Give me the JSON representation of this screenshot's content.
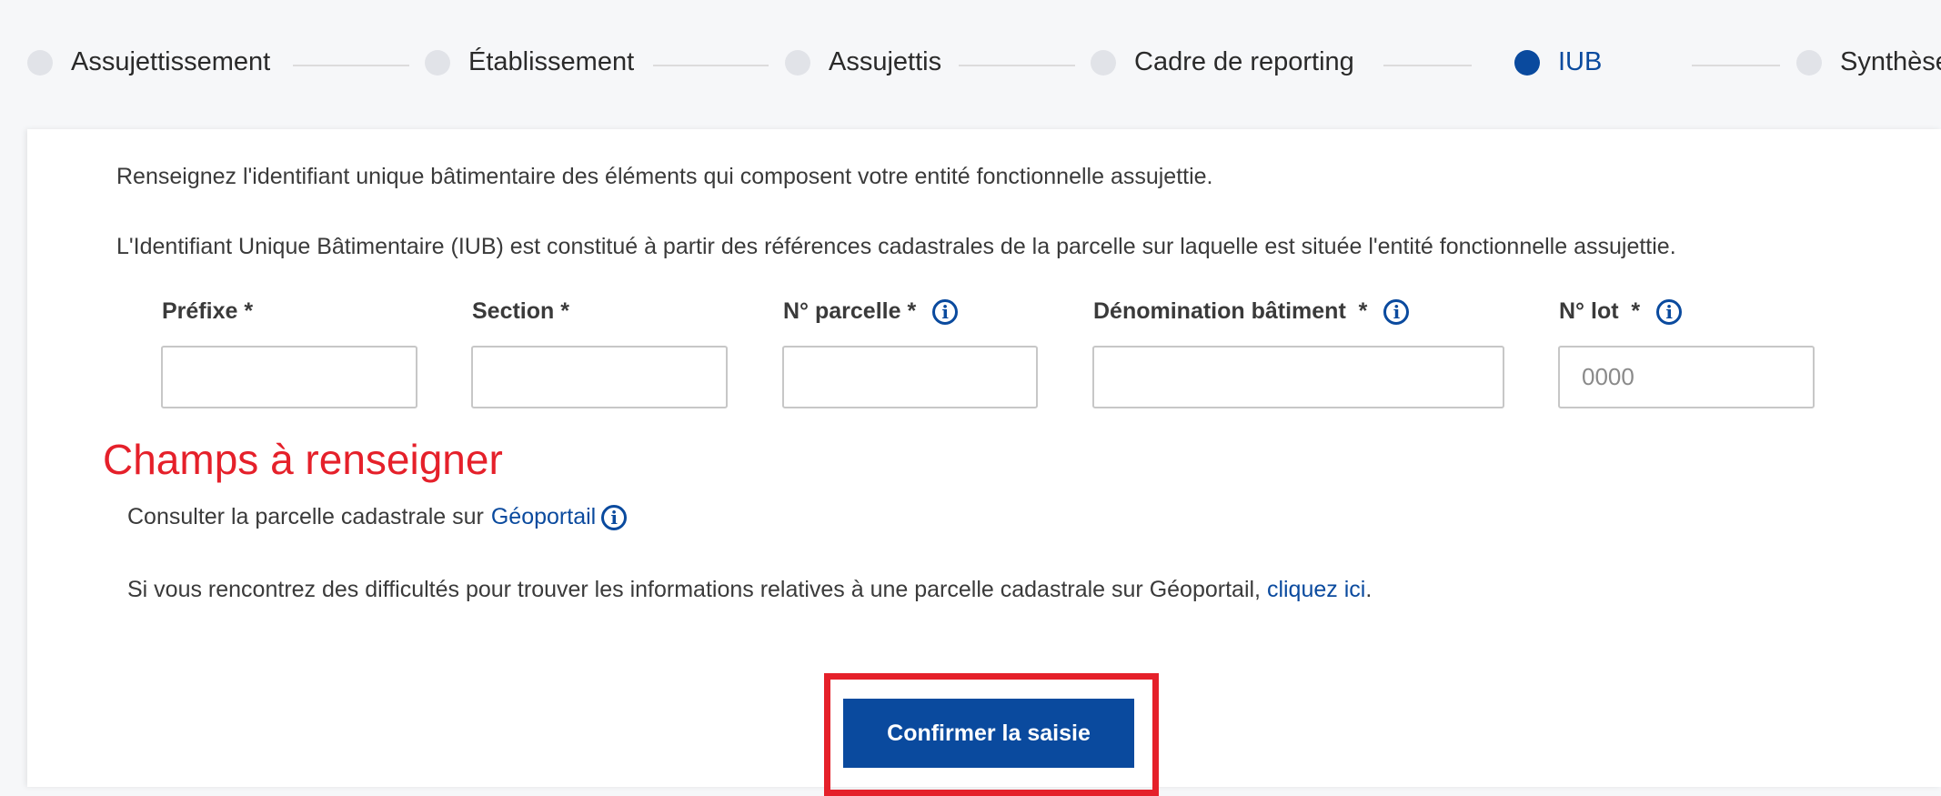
{
  "stepper": {
    "steps": [
      {
        "label": "Assujettissement",
        "active": false
      },
      {
        "label": "Établissement",
        "active": false
      },
      {
        "label": "Assujettis",
        "active": false
      },
      {
        "label": "Cadre de reporting",
        "active": false
      },
      {
        "label": "IUB",
        "active": true
      },
      {
        "label": "Synthèse",
        "active": false
      }
    ]
  },
  "intro": {
    "line1": "Renseignez l'identifiant unique bâtimentaire des éléments qui composent votre entité fonctionnelle assujettie.",
    "line2": "L'Identifiant Unique Bâtimentaire (IUB) est constitué à partir des références cadastrales de la parcelle sur laquelle est située l'entité fonctionnelle assujettie."
  },
  "form": {
    "prefixe": {
      "label": "Préfixe *",
      "value": "",
      "placeholder": ""
    },
    "section": {
      "label": "Section *",
      "value": "",
      "placeholder": ""
    },
    "parcelle": {
      "label": "N° parcelle *",
      "value": "",
      "placeholder": ""
    },
    "batiment": {
      "label": "Dénomination bâtiment  *",
      "value": "",
      "placeholder": ""
    },
    "lot": {
      "label": "N° lot  *",
      "value": "",
      "placeholder": "0000"
    }
  },
  "annotation": "Champs à renseigner",
  "geoportail": {
    "text": "Consulter la parcelle cadastrale sur",
    "link": "Géoportail"
  },
  "help": {
    "text": "Si vous rencontrez des difficultés pour trouver les informations relatives à une parcelle cadastrale sur Géoportail,",
    "link": "cliquez ici",
    "suffix": "."
  },
  "confirm_label": "Confirmer la saisie",
  "colors": {
    "primary": "#0a4a9e",
    "annotation_red": "#e5202a",
    "inactive_dot": "#e1e3e8"
  },
  "icons": {
    "info": "info-circle-icon"
  }
}
